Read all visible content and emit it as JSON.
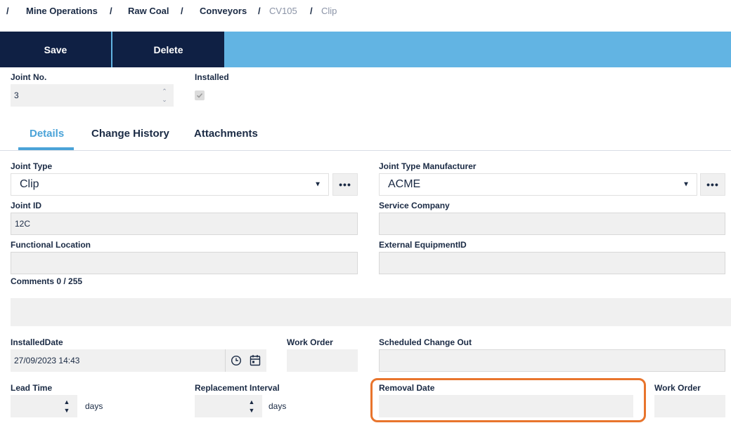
{
  "breadcrumb": {
    "sep": "/",
    "items": [
      "Mine Operations",
      "Raw Coal",
      "Conveyors",
      "CV105",
      "Clip"
    ]
  },
  "toolbar": {
    "save_label": "Save",
    "delete_label": "Delete"
  },
  "header": {
    "joint_no_label": "Joint No.",
    "joint_no_value": "3",
    "installed_label": "Installed",
    "installed_checked": true
  },
  "tabs": [
    "Details",
    "Change History",
    "Attachments"
  ],
  "form": {
    "joint_type_label": "Joint Type",
    "joint_type_value": "Clip",
    "joint_type_mfr_label": "Joint Type Manufacturer",
    "joint_type_mfr_value": "ACME",
    "more_label": "•••",
    "joint_id_label": "Joint ID",
    "joint_id_value": "12C",
    "service_company_label": "Service Company",
    "service_company_value": "",
    "functional_location_label": "Functional Location",
    "functional_location_value": "",
    "external_equipment_label": "External EquipmentID",
    "external_equipment_value": "",
    "comments_label": "Comments 0 / 255",
    "comments_value": "",
    "installed_date_label": "InstalledDate",
    "installed_date_value": "27/09/2023 14:43",
    "work_order_label": "Work Order",
    "work_order_value": "",
    "scheduled_change_label": "Scheduled Change Out",
    "scheduled_change_value": "",
    "lead_time_label": "Lead Time",
    "lead_time_value": "",
    "replacement_interval_label": "Replacement Interval",
    "replacement_interval_value": "",
    "days_label": "days",
    "removal_date_label": "Removal Date",
    "removal_date_value": "",
    "work_order_2_label": "Work Order",
    "work_order_2_value": ""
  },
  "colors": {
    "accent": "#62b4e3",
    "toolbar_button": "#0f2044",
    "highlight_outline": "#e8742c"
  }
}
